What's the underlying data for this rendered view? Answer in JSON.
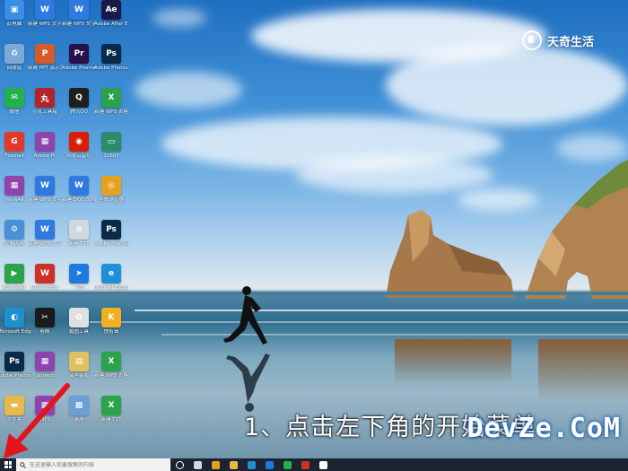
{
  "brand": {
    "name": "天奇生活"
  },
  "caption": "1、点击左下角的开始菜单",
  "watermark": "DevZe.CoM",
  "desktop_icons": [
    {
      "label": "此电脑",
      "color": "#3a8ee6",
      "glyph": "▣"
    },
    {
      "label": "新建 WPS 文字文档",
      "color": "#2f7ae0",
      "glyph": "W"
    },
    {
      "label": "新建 WPS 文字文档",
      "color": "#2f7ae0",
      "glyph": "W"
    },
    {
      "label": "Adobe After Effects 2022",
      "color": "#1a1a4a",
      "glyph": "Ae"
    },
    {
      "label": "回收站",
      "color": "#7da9d6",
      "glyph": "♻"
    },
    {
      "label": "新建 PPT 演示文稿",
      "color": "#d55b2a",
      "glyph": "P"
    },
    {
      "label": "Adobe Premiere",
      "color": "#2a0f4a",
      "glyph": "Pr"
    },
    {
      "label": "Adobe Photoshop",
      "color": "#0a2a4a",
      "glyph": "Ps"
    },
    {
      "label": "微信",
      "color": "#22b14c",
      "glyph": "✉"
    },
    {
      "label": "小丸工具箱",
      "color": "#b3242a",
      "glyph": "丸"
    },
    {
      "label": "腾讯QQ",
      "color": "#1f1f1f",
      "glyph": "Q"
    },
    {
      "label": "新建 WPS 表格",
      "color": "#2aa34a",
      "glyph": "X"
    },
    {
      "label": "Foxmail",
      "color": "#e23a2a",
      "glyph": "G"
    },
    {
      "label": "Adobe Pr",
      "color": "#8e44ad",
      "glyph": "▦"
    },
    {
      "label": "网易云音乐",
      "color": "#d81e06",
      "glyph": "◉"
    },
    {
      "label": "1080P",
      "color": "#2c8c6a",
      "glyph": "▭"
    },
    {
      "label": "WinRAR",
      "color": "#8e44ad",
      "glyph": "▦"
    },
    {
      "label": "新建 WPS 文字",
      "color": "#2f7ae0",
      "glyph": "W"
    },
    {
      "label": "新建 DOC 文档",
      "color": "#2f7ae0",
      "glyph": "W"
    },
    {
      "label": "谷歌浏览器",
      "color": "#e8a020",
      "glyph": "◎"
    },
    {
      "label": "控制面板",
      "color": "#4a90d6",
      "glyph": "⚙"
    },
    {
      "label": "新建 WPS 文字",
      "color": "#2f7ae0",
      "glyph": "W"
    },
    {
      "label": "新建 TXT",
      "color": "#cfd8e0",
      "glyph": "≡"
    },
    {
      "label": "Adobe Photoshop",
      "color": "#0a2a4a",
      "glyph": "Ps"
    },
    {
      "label": "PotPlayer",
      "color": "#2aa34a",
      "glyph": "▶"
    },
    {
      "label": "WPS Office",
      "color": "#d0302a",
      "glyph": "W"
    },
    {
      "label": "飞书",
      "color": "#1f7ae0",
      "glyph": "➤"
    },
    {
      "label": "Internet Explorer",
      "color": "#1e90d6",
      "glyph": "e"
    },
    {
      "label": "Microsoft Edge",
      "color": "#1f8fd0",
      "glyph": "◐"
    },
    {
      "label": "剪映",
      "color": "#1a1a1a",
      "glyph": "✂"
    },
    {
      "label": "截图工具",
      "color": "#e0e0e0",
      "glyph": "✿"
    },
    {
      "label": "快剪辑",
      "color": "#f0b020",
      "glyph": "K"
    },
    {
      "label": "Adobe Photoshop",
      "color": "#0a2a4a",
      "glyph": "Ps"
    },
    {
      "label": "project",
      "color": "#8e44ad",
      "glyph": "▦"
    },
    {
      "label": "会声会影",
      "color": "#e0c060",
      "glyph": "▤"
    },
    {
      "label": "新建 WPS 表格",
      "color": "#2aa34a",
      "glyph": "X"
    },
    {
      "label": "文件夹",
      "color": "#e8b84a",
      "glyph": "▬"
    },
    {
      "label": "WPS",
      "color": "#8e44ad",
      "glyph": "▦"
    },
    {
      "label": "录屏",
      "color": "#6aa0d6",
      "glyph": "▩"
    },
    {
      "label": "新建 TXT",
      "color": "#2aa34a",
      "glyph": "X"
    }
  ],
  "taskbar": {
    "search_placeholder": "在这里输入你要搜索的内容",
    "pinned": [
      {
        "name": "cortana",
        "color": "#ffffff"
      },
      {
        "name": "task-view",
        "color": "#cfd8e0"
      },
      {
        "name": "chrome",
        "color": "#e8a020"
      },
      {
        "name": "file-explorer",
        "color": "#e8b84a"
      },
      {
        "name": "edge",
        "color": "#1f8fd0"
      },
      {
        "name": "feishu",
        "color": "#1f7ae0"
      },
      {
        "name": "wechat",
        "color": "#22b14c"
      },
      {
        "name": "wps",
        "color": "#d0302a"
      },
      {
        "name": "capcut",
        "color": "#ffffff"
      }
    ]
  }
}
